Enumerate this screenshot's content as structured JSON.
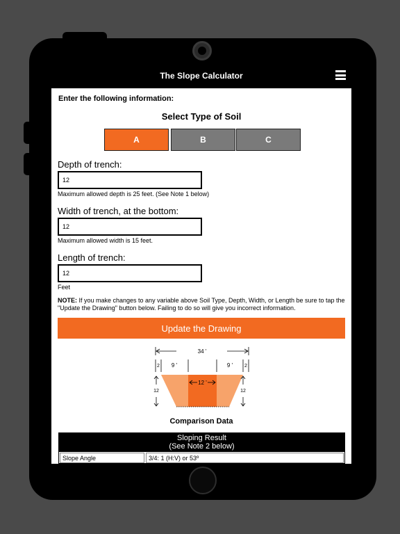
{
  "header": {
    "title": "The Slope Calculator"
  },
  "form": {
    "intro": "Enter the following information:",
    "soil_title": "Select Type of Soil",
    "soil_types": [
      {
        "label": "A",
        "selected": true
      },
      {
        "label": "B",
        "selected": false
      },
      {
        "label": "C",
        "selected": false
      }
    ],
    "depth": {
      "label": "Depth of trench:",
      "value": "12",
      "hint": "Maximum allowed depth is 25 feet. (See Note 1 below)"
    },
    "width": {
      "label": "Width of trench, at the bottom:",
      "value": "12",
      "hint": "Maximum allowed width is 15 feet."
    },
    "length": {
      "label": "Length of trench:",
      "value": "12",
      "hint": "Feet"
    },
    "note_label": "NOTE:",
    "note_text": " If you make changes to any variable above Soil Type, Depth, Width, or Length be sure to tap the \"Update the Drawing\" button below. Failing to do so will give you incorrect information.",
    "update_button": "Update the Drawing"
  },
  "diagram": {
    "top_width": "34 '",
    "left_side": "9 '",
    "right_side": "9 '",
    "left_clear": "2",
    "right_clear": "2",
    "bottom_width": "12 '",
    "left_depth": "12",
    "right_depth": "12"
  },
  "comparison": {
    "title": "Comparison Data",
    "header_line1": "Sloping Result",
    "header_line2": "(See Note 2 below)",
    "rows": [
      {
        "label": "Slope Angle",
        "value": "3/4: 1 (H:V) or 53º"
      }
    ]
  },
  "colors": {
    "accent": "#f26a21",
    "unselected": "#7a7a7a",
    "slope_light": "#f7a36a"
  }
}
